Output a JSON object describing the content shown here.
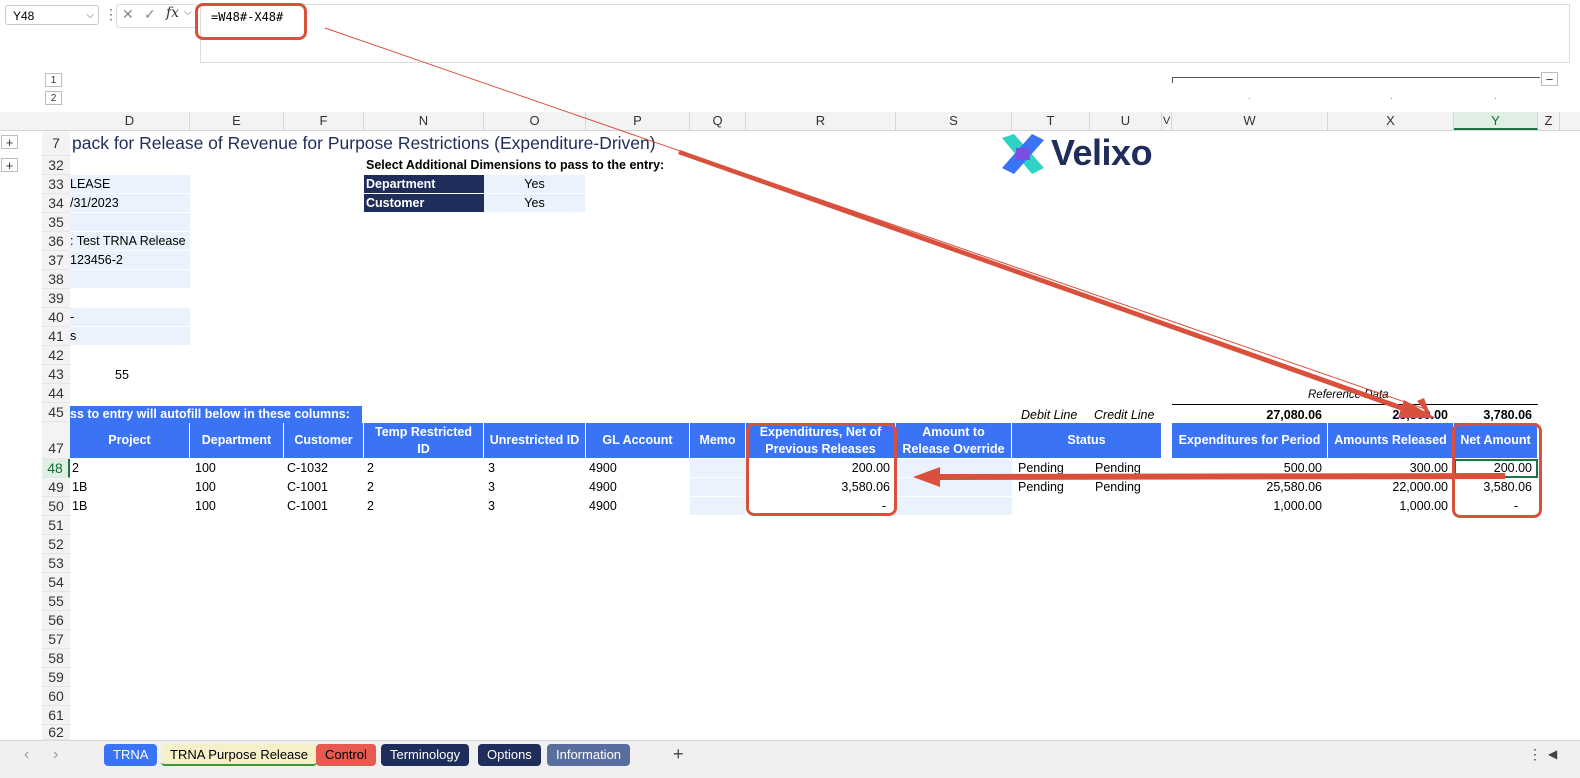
{
  "formula_bar": {
    "name_box": "Y48",
    "cancel_icon": "✕",
    "enter_icon": "✓",
    "fx_label": "fx",
    "formula": "=W48#-X48#"
  },
  "outline": {
    "level1": "1",
    "level2": "2",
    "row_level1": "1",
    "row_level2": "2",
    "expand": "+",
    "collapse": "−"
  },
  "columns": [
    "D",
    "E",
    "F",
    "N",
    "O",
    "P",
    "Q",
    "R",
    "S",
    "T",
    "U",
    "V",
    "W",
    "X",
    "Y",
    "Z"
  ],
  "rows": [
    "7",
    "32",
    "33",
    "34",
    "35",
    "36",
    "37",
    "38",
    "39",
    "40",
    "41",
    "42",
    "43",
    "44",
    "45",
    "47",
    "48",
    "49",
    "50",
    "51",
    "52",
    "53",
    "54",
    "55",
    "56",
    "57",
    "58",
    "59",
    "60",
    "61",
    "62"
  ],
  "sheet": {
    "title": "pack for Release of Revenue for Purpose Restrictions (Expenditure-Driven)",
    "logo_text": "Velixo",
    "dimensions_heading": "Select Additional Dimensions to pass to the entry:",
    "dimensions": [
      {
        "label": "Department",
        "value": "Yes"
      },
      {
        "label": "Customer",
        "value": "Yes"
      }
    ],
    "left_values": {
      "r33": "LEASE",
      "r34": "/31/2023",
      "r36": ": Test TRNA Release",
      "r37": "123456-2",
      "r40": "-",
      "r41": "s",
      "r43": "55"
    },
    "autofill_note": "ss to entry will autofill below in these columns:",
    "reference_label": "Reference Data",
    "debit_line": "Debit Line",
    "credit_line": "Credit Line",
    "totals": {
      "w": "27,080.06",
      "x": "23,300.00",
      "y": "3,780.06"
    },
    "headers": {
      "project": "Project",
      "department": "Department",
      "customer": "Customer",
      "temp_restricted_id": "Temp Restricted ID",
      "unrestricted_id": "Unrestricted ID",
      "gl_account": "GL Account",
      "memo": "Memo",
      "expenditures_net": "Expenditures, Net of Previous Releases",
      "amount_override": "Amount to Release Override",
      "status": "Status",
      "expenditures_period": "Expenditures for Period",
      "amounts_released": "Amounts Released",
      "net_amount": "Net Amount"
    },
    "data_rows": [
      {
        "project": "2",
        "department": "100",
        "customer": "C-1032",
        "temp": "2",
        "unres": "3",
        "gl": "4900",
        "memo": "",
        "net_prev": "200.00",
        "override": "",
        "status_debit": "Pending",
        "status_credit": "Pending",
        "exp_period": "500.00",
        "released": "300.00",
        "net": "200.00"
      },
      {
        "project": "1B",
        "department": "100",
        "customer": "C-1001",
        "temp": "2",
        "unres": "3",
        "gl": "4900",
        "memo": "",
        "net_prev": "3,580.06",
        "override": "",
        "status_debit": "Pending",
        "status_credit": "Pending",
        "exp_period": "25,580.06",
        "released": "22,000.00",
        "net": "3,580.06"
      },
      {
        "project": "1B",
        "department": "100",
        "customer": "C-1001",
        "temp": "2",
        "unres": "3",
        "gl": "4900",
        "memo": "",
        "net_prev": "-",
        "override": "",
        "status_debit": "",
        "status_credit": "",
        "exp_period": "1,000.00",
        "released": "1,000.00",
        "net": "-"
      }
    ]
  },
  "tabs": {
    "prev": "‹",
    "next": "›",
    "items": [
      {
        "label": "TRNA",
        "color": "#3b73f5"
      },
      {
        "label": "TRNA Purpose Release",
        "color": "#f5f0c8"
      },
      {
        "label": "Control",
        "color": "#e85a4f"
      },
      {
        "label": "Terminology",
        "color": "#1f2d5a"
      },
      {
        "label": "Options",
        "color": "#1f2d5a"
      },
      {
        "label": "Information",
        "color": "#5a6e9e"
      }
    ],
    "add": "+",
    "more": "⋮"
  }
}
